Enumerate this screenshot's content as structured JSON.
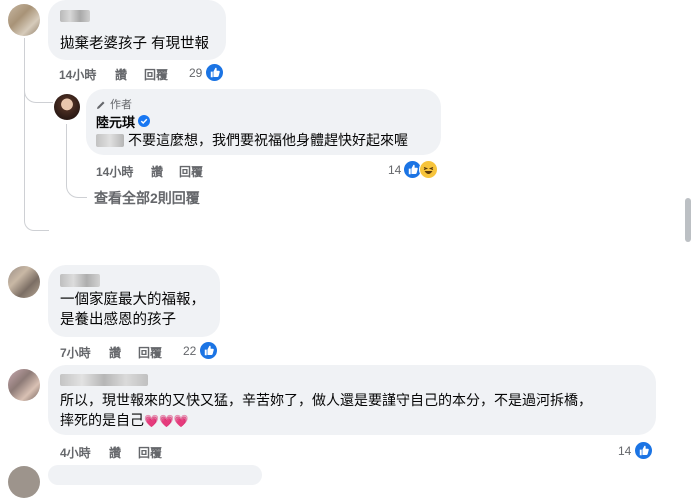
{
  "comments": [
    {
      "text": "拋棄老婆孩子 有現世報",
      "time": "14小時",
      "like_label": "讚",
      "reply_label": "回覆",
      "reaction_count": "29"
    },
    {
      "author_badge": "作者",
      "author": "陸元琪",
      "text": "不要這麼想，我們要祝福他身體趕快好起來喔",
      "time": "14小時",
      "like_label": "讚",
      "reply_label": "回覆",
      "reaction_count": "14"
    },
    {
      "text_line1": "一個家庭最大的福報，",
      "text_line2": "是養出感恩的孩子",
      "time": "7小時",
      "like_label": "讚",
      "reply_label": "回覆",
      "reaction_count": "22"
    },
    {
      "text_line1": "所以，現世報來的又快又猛，辛苦妳了，做人還是要謹守自己的本分，不是過河拆橋，",
      "text_line2": "摔死的是自己",
      "hearts": "💗💗💗",
      "time": "4小時",
      "like_label": "讚",
      "reply_label": "回覆",
      "reaction_count": "14"
    }
  ],
  "view_replies_label": "查看全部2則回覆",
  "colors": {
    "bubble": "#f0f2f5",
    "meta_text": "#65676b",
    "like_blue": "#1b74e4",
    "verified_blue": "#1877f2",
    "thread_line": "#ced0d4"
  },
  "icons": [
    "like-icon",
    "haha-icon",
    "verified-badge-icon",
    "pencil-icon"
  ]
}
